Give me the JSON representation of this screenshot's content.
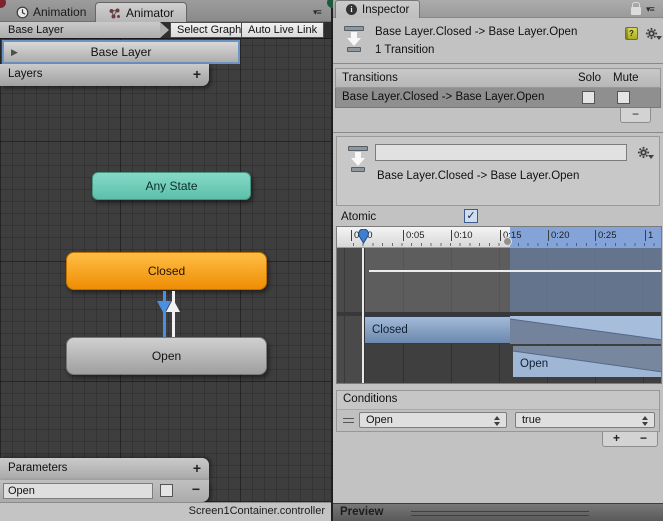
{
  "animator": {
    "tab_animation": "Animation",
    "tab_animator": "Animator",
    "breadcrumb": "Base Layer",
    "select_graph": "Select Graph",
    "auto_live_link": "Auto Live Link",
    "layer_selected": "Base Layer",
    "layers_label": "Layers",
    "layers_add": "+",
    "node_any_state": "Any State",
    "node_closed": "Closed",
    "node_open": "Open",
    "parameters_label": "Parameters",
    "parameters_add": "+",
    "parameter_row": {
      "name": "Open",
      "checked": false,
      "remove": "−"
    },
    "status_file": "Screen1Container.controller"
  },
  "inspector": {
    "tab": "Inspector",
    "title": "Base Layer.Closed -> Base Layer.Open",
    "subtitle": "1 Transition",
    "transitions": {
      "header": "Transitions",
      "solo": "Solo",
      "mute": "Mute",
      "row_label": "Base Layer.Closed -> Base Layer.Open",
      "row_solo_checked": false,
      "row_mute_checked": false,
      "remove": "−"
    },
    "detail": {
      "name_value": "",
      "label": "Base Layer.Closed -> Base Layer.Open"
    },
    "atomic_label": "Atomic",
    "atomic_checked": true,
    "timeline": {
      "ticks": [
        "0:00",
        "0:05",
        "0:10",
        "0:15",
        "0:20",
        "0:25",
        "1"
      ],
      "track_a": "Closed",
      "track_b": "Open",
      "playhead_position": "0:00",
      "transition_start": "0:15"
    },
    "conditions": {
      "header": "Conditions",
      "param": "Open",
      "value": "true",
      "add": "+",
      "remove": "−"
    },
    "preview": "Preview"
  },
  "icons": {
    "check": "✓",
    "menu": "▾≡",
    "play_triangle": "▶"
  },
  "colors": {
    "closed_node": "#EF8D05",
    "any_state_node": "#5CC0AB",
    "selection_blue": "#4A90E2",
    "timeline_blue": "#84A4D9",
    "graph_background": "#3E3E3E"
  }
}
